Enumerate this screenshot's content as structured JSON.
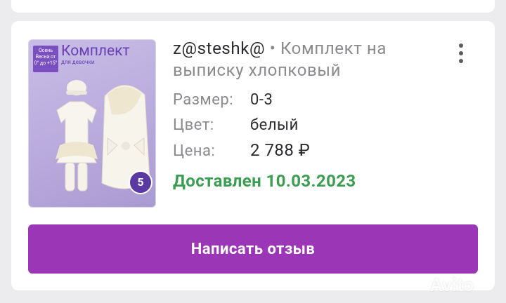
{
  "order": {
    "seller": "z@steshk@",
    "separator": " • ",
    "product_title": "Комплект на выписку хлопковый",
    "thumbnail": {
      "season_label": "Осень Весна от 0° до +15°",
      "title": "Комплект",
      "subtitle": "для девочки",
      "badge": "5"
    },
    "details": [
      {
        "label": "Размер:",
        "value": "0-3"
      },
      {
        "label": "Цвет:",
        "value": "белый"
      },
      {
        "label": "Цена:",
        "value": "2 788 ₽"
      }
    ],
    "status": "Доставлен 10.03.2023",
    "review_button": "Написать отзыв"
  },
  "watermark": "Avito",
  "colors": {
    "accent": "#9b36b7",
    "status_green": "#3a9d52"
  }
}
